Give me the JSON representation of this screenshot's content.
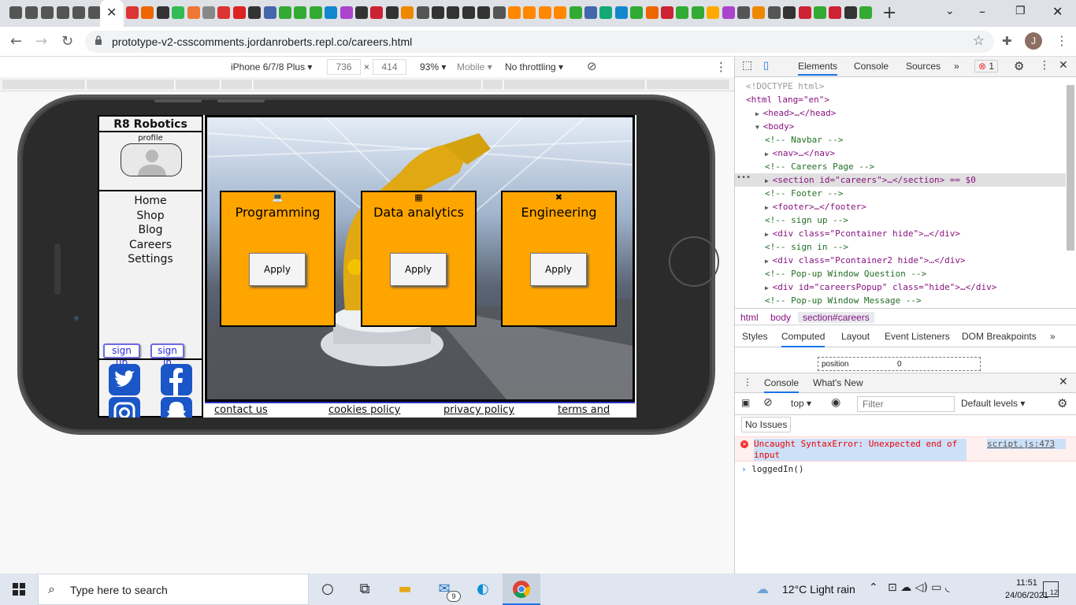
{
  "browser": {
    "url": "prototype-v2-csscomments.jordanroberts.repl.co/careers.html",
    "profile_initial": "J",
    "window_controls": [
      "–",
      "❐",
      "✕"
    ]
  },
  "device_toolbar": {
    "device": "iPhone 6/7/8 Plus",
    "width": "736",
    "height": "414",
    "zoom": "93%",
    "mode": "Mobile",
    "throttle": "No throttling"
  },
  "site": {
    "brand": "R8 Robotics",
    "profile_label": "profile",
    "nav": [
      "Home",
      "Shop",
      "Blog",
      "Careers",
      "Settings"
    ],
    "sign_up": "sign up",
    "sign_in": "sign in",
    "cards": [
      {
        "title": "Programming",
        "icon": "laptop-icon",
        "button": "Apply"
      },
      {
        "title": "Data analytics",
        "icon": "chart-icon",
        "button": "Apply"
      },
      {
        "title": "Engineering",
        "icon": "tools-icon",
        "button": "Apply"
      }
    ],
    "footer": [
      "contact us",
      "cookies policy",
      "privacy policy",
      "terms and"
    ],
    "colors": {
      "card": "#ffa500",
      "social": "#1a56c7"
    }
  },
  "devtools": {
    "tabs": [
      "Elements",
      "Console",
      "Sources"
    ],
    "error_count": "1",
    "dom": [
      {
        "indent": 0,
        "cmt": "<!DOCTYPE html>"
      },
      {
        "indent": 0,
        "text": "<html lang=\"en\">"
      },
      {
        "indent": 1,
        "arrow": "▶",
        "text": "<head>…</head>"
      },
      {
        "indent": 1,
        "arrow": "▼",
        "text": "<body>"
      },
      {
        "indent": 2,
        "cmt": "<!-- Navbar -->"
      },
      {
        "indent": 2,
        "arrow": "▶",
        "text": "<nav>…</nav>"
      },
      {
        "indent": 2,
        "cmt": "<!-- Careers Page -->"
      },
      {
        "indent": 2,
        "arrow": "▶",
        "text": "<section id=\"careers\">…</section> == $0",
        "selected": true
      },
      {
        "indent": 2,
        "cmt": "<!-- Footer -->"
      },
      {
        "indent": 2,
        "arrow": "▶",
        "text": "<footer>…</footer>"
      },
      {
        "indent": 2,
        "cmt": "<!-- sign up -->"
      },
      {
        "indent": 2,
        "arrow": "▶",
        "text": "<div class=\"Pcontainer hide\">…</div>"
      },
      {
        "indent": 2,
        "cmt": "<!-- sign in -->"
      },
      {
        "indent": 2,
        "arrow": "▶",
        "text": "<div class=\"Pcontainer2 hide\">…</div>"
      },
      {
        "indent": 2,
        "cmt": "<!-- Pop-up Window Question -->"
      },
      {
        "indent": 2,
        "arrow": "▶",
        "text": "<div id=\"careersPopup\" class=\"hide\">…</div>"
      },
      {
        "indent": 2,
        "cmt": "<!-- Pop-up Window Message -->"
      }
    ],
    "breadcrumbs": [
      "html",
      "body",
      "section#careers"
    ],
    "style_tabs": [
      "Styles",
      "Computed",
      "Layout",
      "Event Listeners",
      "DOM Breakpoints"
    ],
    "computed_prop": "position",
    "computed_val": "0",
    "console_tabs": [
      "Console",
      "What's New"
    ],
    "context": "top",
    "filter_placeholder": "Filter",
    "levels": "Default levels",
    "no_issues": "No Issues",
    "error_message": "Uncaught SyntaxError: Unexpected end of input",
    "error_source": "script.js:473",
    "console_input": "loggedIn()"
  },
  "taskbar": {
    "search_placeholder": "Type here to search",
    "weather": "12°C  Light rain",
    "time": "11:51",
    "date": "24/06/2021",
    "mail_badge": "9",
    "notifications": "12"
  }
}
